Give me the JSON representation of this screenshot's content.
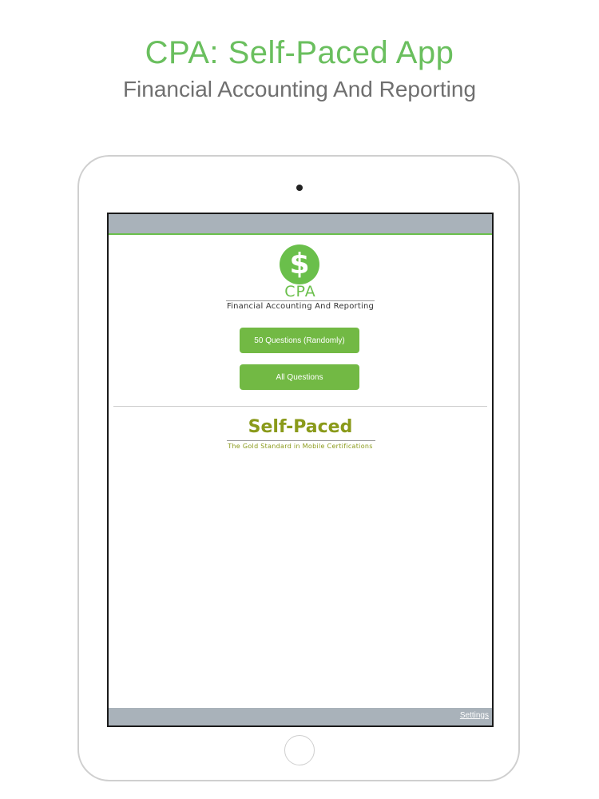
{
  "promo": {
    "title": "CPA: Self-Paced App",
    "subtitle": "Financial Accounting And Reporting"
  },
  "app": {
    "logo_symbol": "$",
    "logo_name": "CPA",
    "logo_subtitle": "Financial Accounting And Reporting",
    "buttons": {
      "random_label": "50 Questions (Randomly)",
      "all_label": "All Questions"
    },
    "brand": {
      "name": "Self-Paced",
      "tagline": "The Gold Standard in Mobile Certifications"
    },
    "settings_label": "Settings"
  },
  "colors": {
    "accent_green": "#6abf5e",
    "button_green": "#72b944",
    "brand_olive": "#8a9a1a",
    "bar_gray": "#a9b2ba"
  }
}
